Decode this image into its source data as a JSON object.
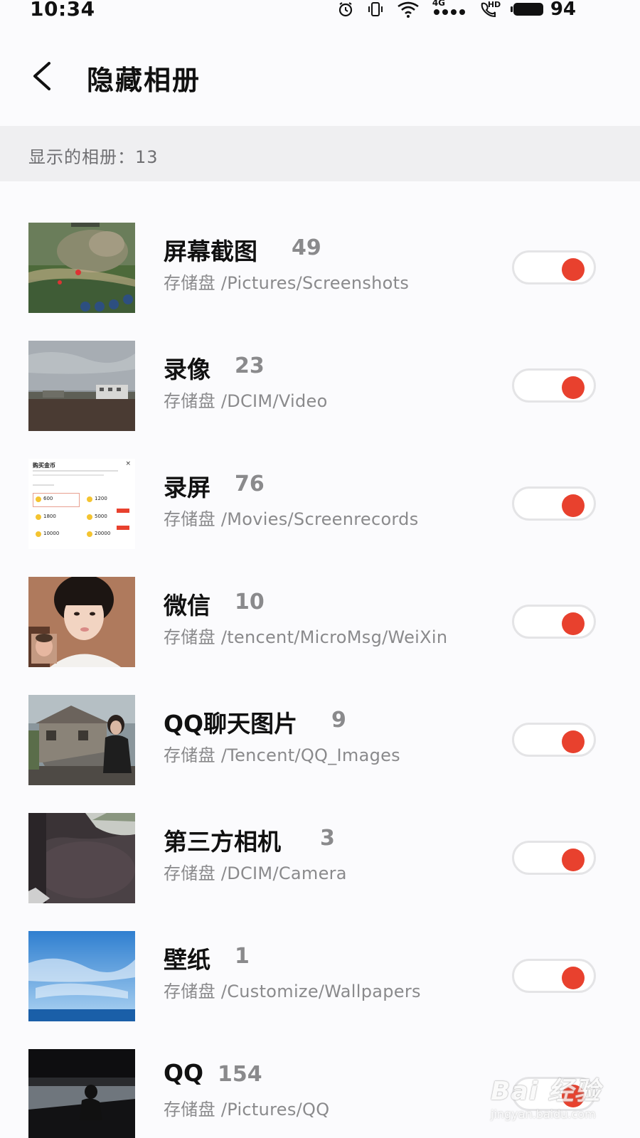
{
  "status_bar": {
    "time": "10:34",
    "network_label": "4G",
    "hd_label": "HD",
    "battery_level": "94",
    "icons": [
      "alarm-icon",
      "vibrate-icon",
      "wifi-icon",
      "signal-icon",
      "hd-call-icon",
      "battery-icon"
    ]
  },
  "header": {
    "title": "隐藏相册",
    "back_icon": "chevron-left-icon"
  },
  "section": {
    "label": "显示的相册：13"
  },
  "albums": [
    {
      "name": "屏幕截图",
      "count": "49",
      "path": "存储盘 /Pictures/Screenshots",
      "enabled": true
    },
    {
      "name": "录像",
      "count": "23",
      "path": "存储盘 /DCIM/Video",
      "enabled": true
    },
    {
      "name": "录屏",
      "count": "76",
      "path": "存储盘 /Movies/Screenrecords",
      "enabled": true
    },
    {
      "name": "微信",
      "count": "10",
      "path": "存储盘 /tencent/MicroMsg/WeiXin",
      "enabled": true
    },
    {
      "name": "QQ聊天图片",
      "count": "9",
      "path": "存储盘 /Tencent/QQ_Images",
      "enabled": true
    },
    {
      "name": "第三方相机",
      "count": "3",
      "path": "存储盘 /DCIM/Camera",
      "enabled": true
    },
    {
      "name": "壁纸",
      "count": "1",
      "path": "存储盘 /Customize/Wallpapers",
      "enabled": true
    },
    {
      "name": "QQ",
      "count": "154",
      "path": "存储盘 /Pictures/QQ",
      "enabled": true
    }
  ],
  "thumb_text": {
    "screenshot": {
      "title": "购买金币",
      "coins": [
        "600",
        "1200",
        "1800",
        "5000",
        "10000",
        "20000"
      ]
    }
  },
  "watermark": {
    "text": "Bai 经验",
    "sub": "jingyan.baidu.com"
  },
  "colors": {
    "accent": "#e8412e",
    "section_bg": "#efeff1",
    "secondary_text": "#8a8a8c"
  }
}
